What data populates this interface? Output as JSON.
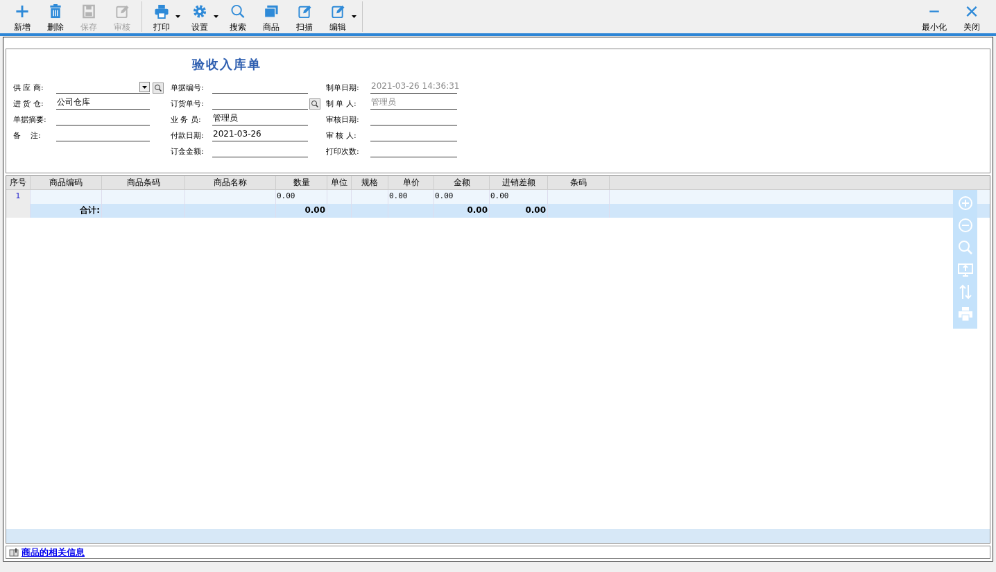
{
  "toolbar": {
    "buttons": [
      {
        "label": "新增",
        "disabled": false,
        "dropdown": false
      },
      {
        "label": "删除",
        "disabled": false,
        "dropdown": false
      },
      {
        "label": "保存",
        "disabled": true,
        "dropdown": false
      },
      {
        "label": "审核",
        "disabled": true,
        "dropdown": false
      },
      {
        "label": "打印",
        "disabled": false,
        "dropdown": true
      },
      {
        "label": "设置",
        "disabled": false,
        "dropdown": true
      },
      {
        "label": "搜索",
        "disabled": false,
        "dropdown": false
      },
      {
        "label": "商品",
        "disabled": false,
        "dropdown": false
      },
      {
        "label": "扫描",
        "disabled": false,
        "dropdown": false
      },
      {
        "label": "编辑",
        "disabled": false,
        "dropdown": true
      }
    ],
    "window_buttons": [
      {
        "label": "最小化"
      },
      {
        "label": "关闭"
      }
    ]
  },
  "form": {
    "title": "验收入库单",
    "columns": [
      [
        {
          "label": "供 应 商:",
          "kind": "dropdown"
        },
        {
          "label": "进 货 仓:",
          "kind": "text",
          "value": "公司仓库"
        },
        {
          "label": "单据摘要:",
          "kind": "text"
        },
        {
          "label": "备    注:",
          "kind": "text"
        }
      ],
      [
        {
          "label": "单据编号:",
          "kind": "text"
        },
        {
          "label": "订货单号:",
          "kind": "lookup"
        },
        {
          "label": "业 务 员:",
          "kind": "text",
          "value": "管理员"
        },
        {
          "label": "付款日期:",
          "kind": "text",
          "value": "2021-03-26"
        },
        {
          "label": "订金金额:",
          "kind": "text"
        }
      ],
      [
        {
          "label": "制单日期:",
          "kind": "readonly",
          "value": "2021-03-26 14:36:31"
        },
        {
          "label": "制 单 人:",
          "kind": "readonly",
          "value": "管理员"
        },
        {
          "label": "审核日期:",
          "kind": "text"
        },
        {
          "label": "审 核 人:",
          "kind": "text"
        },
        {
          "label": "打印次数:",
          "kind": "text"
        }
      ]
    ]
  },
  "table": {
    "columns": [
      "序号",
      "商品编码",
      "商品条码",
      "商品名称",
      "数量",
      "单位",
      "规格",
      "单价",
      "金额",
      "进销差额",
      "条码"
    ],
    "rows": [
      {
        "number": "1",
        "quantity": "0.00",
        "unit_price": "0.00",
        "amount": "0.00",
        "difference": "0.00"
      }
    ],
    "total": {
      "label": "合计:",
      "quantity": "0.00",
      "amount": "0.00",
      "difference": "0.00"
    }
  },
  "footer": {
    "link": "商品的相关信息"
  }
}
